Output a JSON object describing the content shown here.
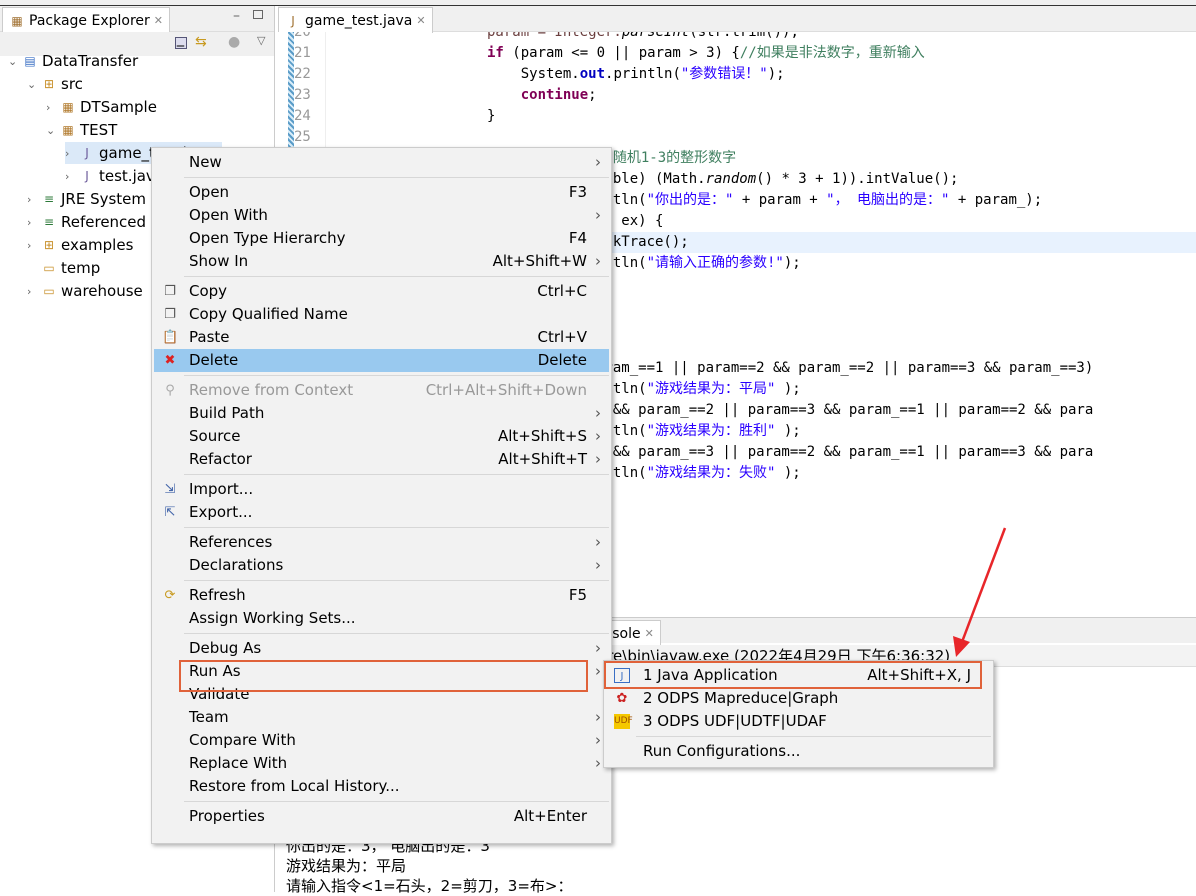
{
  "package_explorer": {
    "title": "Package Explorer",
    "tree": [
      {
        "label": "DataTransfer",
        "icon": "odps-project-icon",
        "level": 0,
        "expanded": true
      },
      {
        "label": "src",
        "icon": "source-folder-icon",
        "level": 1,
        "expanded": true
      },
      {
        "label": "DTSample",
        "icon": "package-icon",
        "level": 2,
        "expanded": false
      },
      {
        "label": "TEST",
        "icon": "package-icon",
        "level": 2,
        "expanded": true
      },
      {
        "label": "game_test.java",
        "icon": "java-file-icon",
        "level": 3,
        "expanded": false,
        "selected": true
      },
      {
        "label": "test.java",
        "icon": "java-file-icon",
        "level": 3,
        "expanded": false
      },
      {
        "label": "JRE System Library",
        "icon": "library-icon",
        "level": 1,
        "expanded": false
      },
      {
        "label": "Referenced Libraries",
        "icon": "library-icon",
        "level": 1,
        "expanded": false
      },
      {
        "label": "examples",
        "icon": "source-folder-icon",
        "level": 1,
        "expanded": false
      },
      {
        "label": "temp",
        "icon": "folder-icon",
        "level": 1,
        "expanded": null
      },
      {
        "label": "warehouse",
        "icon": "folder-icon",
        "level": 1,
        "expanded": false
      }
    ]
  },
  "editor": {
    "tab": "game_test.java",
    "line_numbers": [
      "20",
      "21",
      "22",
      "23",
      "24",
      "25"
    ],
    "lines": [
      [
        [
          "param = Integer.",
          "var"
        ],
        [
          "parseInt",
          "it"
        ],
        [
          "(str.trim());",
          ""
        ]
      ],
      [
        [
          "if",
          "kw"
        ],
        [
          " (param <= 0 || param > 3) {",
          ""
        ],
        [
          "//如果是非法数字，重新输入",
          "cm"
        ]
      ],
      [
        [
          "    System.",
          ""
        ],
        [
          "out",
          "fld"
        ],
        [
          ".println(",
          ""
        ],
        [
          "\"参数错误！\"",
          "str"
        ],
        [
          ");",
          ""
        ]
      ],
      [
        [
          "    ",
          ""
        ],
        [
          "continue",
          "kw"
        ],
        [
          ";",
          ""
        ]
      ],
      [
        [
          "}",
          ""
        ]
      ],
      [
        [
          "",
          ""
        ]
      ],
      [
        [
          "/ ",
          "cm"
        ],
        [
          "随机1-3的整形数字",
          "cm"
        ]
      ],
      [
        [
          "ouble) (Math.",
          ""
        ],
        [
          "random",
          "it"
        ],
        [
          "() * 3 + 1)).intValue();",
          ""
        ]
      ],
      [
        [
          "intln(",
          ""
        ],
        [
          "\"你出的是：\"",
          "str"
        ],
        [
          " + param + ",
          ""
        ],
        [
          "\"， 电脑出的是：\"",
          "str"
        ],
        [
          " + param_);",
          ""
        ]
      ],
      [
        [
          "on ex) {",
          ""
        ]
      ],
      [
        [
          "ackTrace();",
          ""
        ]
      ],
      [
        [
          "intln(",
          ""
        ],
        [
          "\"请输入正确的参数!\"",
          "str"
        ],
        [
          ");",
          ""
        ]
      ],
      [
        [
          "",
          ""
        ]
      ],
      [
        [
          "",
          ""
        ]
      ],
      [
        [
          "",
          ""
        ]
      ],
      [
        [
          "",
          ""
        ]
      ],
      [
        [
          "aram_==1 || param==2 && param_==2 || param==3 && param_==3)",
          ""
        ]
      ],
      [
        [
          "intln(",
          ""
        ],
        [
          "\"游戏结果为：平局\"",
          "str"
        ],
        [
          " );",
          ""
        ]
      ],
      [
        [
          "l && param_==2 || param==3 && param_==1 || param==2 && para",
          ""
        ]
      ],
      [
        [
          "intln(",
          ""
        ],
        [
          "\"游戏结果为：胜利\"",
          "str"
        ],
        [
          " );",
          ""
        ]
      ],
      [
        [
          "l && param_==3 || param==2 && param_==1 || param==3 && para",
          ""
        ]
      ],
      [
        [
          "intln(",
          ""
        ],
        [
          "\"游戏结果为：失败\"",
          "str"
        ],
        [
          " );",
          ""
        ]
      ]
    ]
  },
  "console": {
    "tab": "Console",
    "header": "\\jre\\bin\\javaw.exe (2022年4月29日 下午6:36:32)",
    "output": [
      "你出的是：3， 电脑出的是：3",
      "游戏结果为：平局",
      "请输入指令<1=石头，2=剪刀，3=布>："
    ]
  },
  "context_menu": {
    "items": [
      {
        "label": "New",
        "shortcut": "",
        "submenu": true
      },
      {
        "sep": true
      },
      {
        "label": "Open",
        "shortcut": "F3"
      },
      {
        "label": "Open With",
        "shortcut": "",
        "submenu": true
      },
      {
        "label": "Open Type Hierarchy",
        "shortcut": "F4"
      },
      {
        "label": "Show In",
        "shortcut": "Alt+Shift+W",
        "submenu": true
      },
      {
        "sep": true
      },
      {
        "label": "Copy",
        "shortcut": "Ctrl+C",
        "icon": "copy-icon"
      },
      {
        "label": "Copy Qualified Name",
        "shortcut": "",
        "icon": "copy-qualified-icon"
      },
      {
        "label": "Paste",
        "shortcut": "Ctrl+V",
        "icon": "paste-icon"
      },
      {
        "label": "Delete",
        "shortcut": "Delete",
        "icon": "delete-icon",
        "selected": true
      },
      {
        "sep": true
      },
      {
        "label": "Remove from Context",
        "shortcut": "Ctrl+Alt+Shift+Down",
        "icon": "remove-context-icon",
        "disabled": true
      },
      {
        "label": "Build Path",
        "shortcut": "",
        "submenu": true
      },
      {
        "label": "Source",
        "shortcut": "Alt+Shift+S",
        "submenu": true
      },
      {
        "label": "Refactor",
        "shortcut": "Alt+Shift+T",
        "submenu": true
      },
      {
        "sep": true
      },
      {
        "label": "Import...",
        "shortcut": "",
        "icon": "import-icon"
      },
      {
        "label": "Export...",
        "shortcut": "",
        "icon": "export-icon"
      },
      {
        "sep": true
      },
      {
        "label": "References",
        "shortcut": "",
        "submenu": true
      },
      {
        "label": "Declarations",
        "shortcut": "",
        "submenu": true
      },
      {
        "sep": true
      },
      {
        "label": "Refresh",
        "shortcut": "F5",
        "icon": "refresh-icon"
      },
      {
        "label": "Assign Working Sets...",
        "shortcut": ""
      },
      {
        "sep": true
      },
      {
        "label": "Debug As",
        "shortcut": "",
        "submenu": true
      },
      {
        "label": "Run As",
        "shortcut": "",
        "submenu": true,
        "highlighted": true
      },
      {
        "label": "Validate",
        "shortcut": ""
      },
      {
        "label": "Team",
        "shortcut": "",
        "submenu": true
      },
      {
        "label": "Compare With",
        "shortcut": "",
        "submenu": true
      },
      {
        "label": "Replace With",
        "shortcut": "",
        "submenu": true
      },
      {
        "label": "Restore from Local History...",
        "shortcut": ""
      },
      {
        "sep": true
      },
      {
        "label": "Properties",
        "shortcut": "Alt+Enter"
      }
    ]
  },
  "run_as_submenu": {
    "items": [
      {
        "label": "1 Java Application",
        "shortcut": "Alt+Shift+X, J",
        "icon": "java-app-icon",
        "highlighted": true
      },
      {
        "label": "2 ODPS Mapreduce|Graph",
        "shortcut": "",
        "icon": "odps-mapreduce-icon"
      },
      {
        "label": "3 ODPS UDF|UDTF|UDAF",
        "shortcut": "",
        "icon": "udf-icon"
      },
      {
        "sep": true
      },
      {
        "label": "Run Configurations...",
        "shortcut": ""
      }
    ]
  },
  "colors": {
    "highlight_box": "#e0623a",
    "arrow": "#e8262a",
    "selection": "#99c9ef"
  }
}
